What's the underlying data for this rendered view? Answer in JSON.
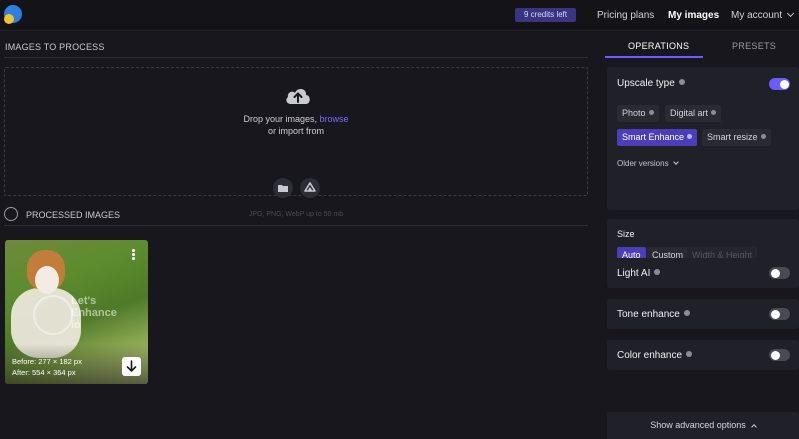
{
  "header": {
    "credits": "9 credits left",
    "nav": [
      "Pricing plans",
      "My images",
      "My account"
    ]
  },
  "main": {
    "images_to_process": "IMAGES TO PROCESS",
    "drop_text": "Drop your images,",
    "browse": "browse",
    "import_text": "or import from",
    "formats": "JPG, PNG, WebP up to 50 mb",
    "processed_images": "PROCESSED IMAGES"
  },
  "card": {
    "watermark_line1": "Let's",
    "watermark_line2": "Enhance",
    "watermark_line3": "io",
    "before": "Before: 277 × 182 px",
    "after": "After: 554 × 364 px"
  },
  "sidebar": {
    "tabs": [
      "OPERATIONS",
      "PRESETS"
    ],
    "upscale": {
      "title": "Upscale type",
      "enabled": true,
      "options": [
        "Photo",
        "Digital art",
        "Smart Enhance",
        "Smart resize"
      ],
      "selected": "Smart Enhance",
      "older_versions": "Older versions"
    },
    "size": {
      "title": "Size",
      "options": [
        "Auto",
        "Custom",
        "Width & Height"
      ],
      "selected": "Auto"
    },
    "light_ai": {
      "title": "Light AI",
      "enabled": false
    },
    "tone_enhance": {
      "title": "Tone enhance",
      "enabled": false
    },
    "color_enhance": {
      "title": "Color enhance",
      "enabled": false
    },
    "advanced": "Show advanced options"
  },
  "colors": {
    "accent": "#6a5cff",
    "background": "#17171d",
    "panel": "#202028"
  }
}
